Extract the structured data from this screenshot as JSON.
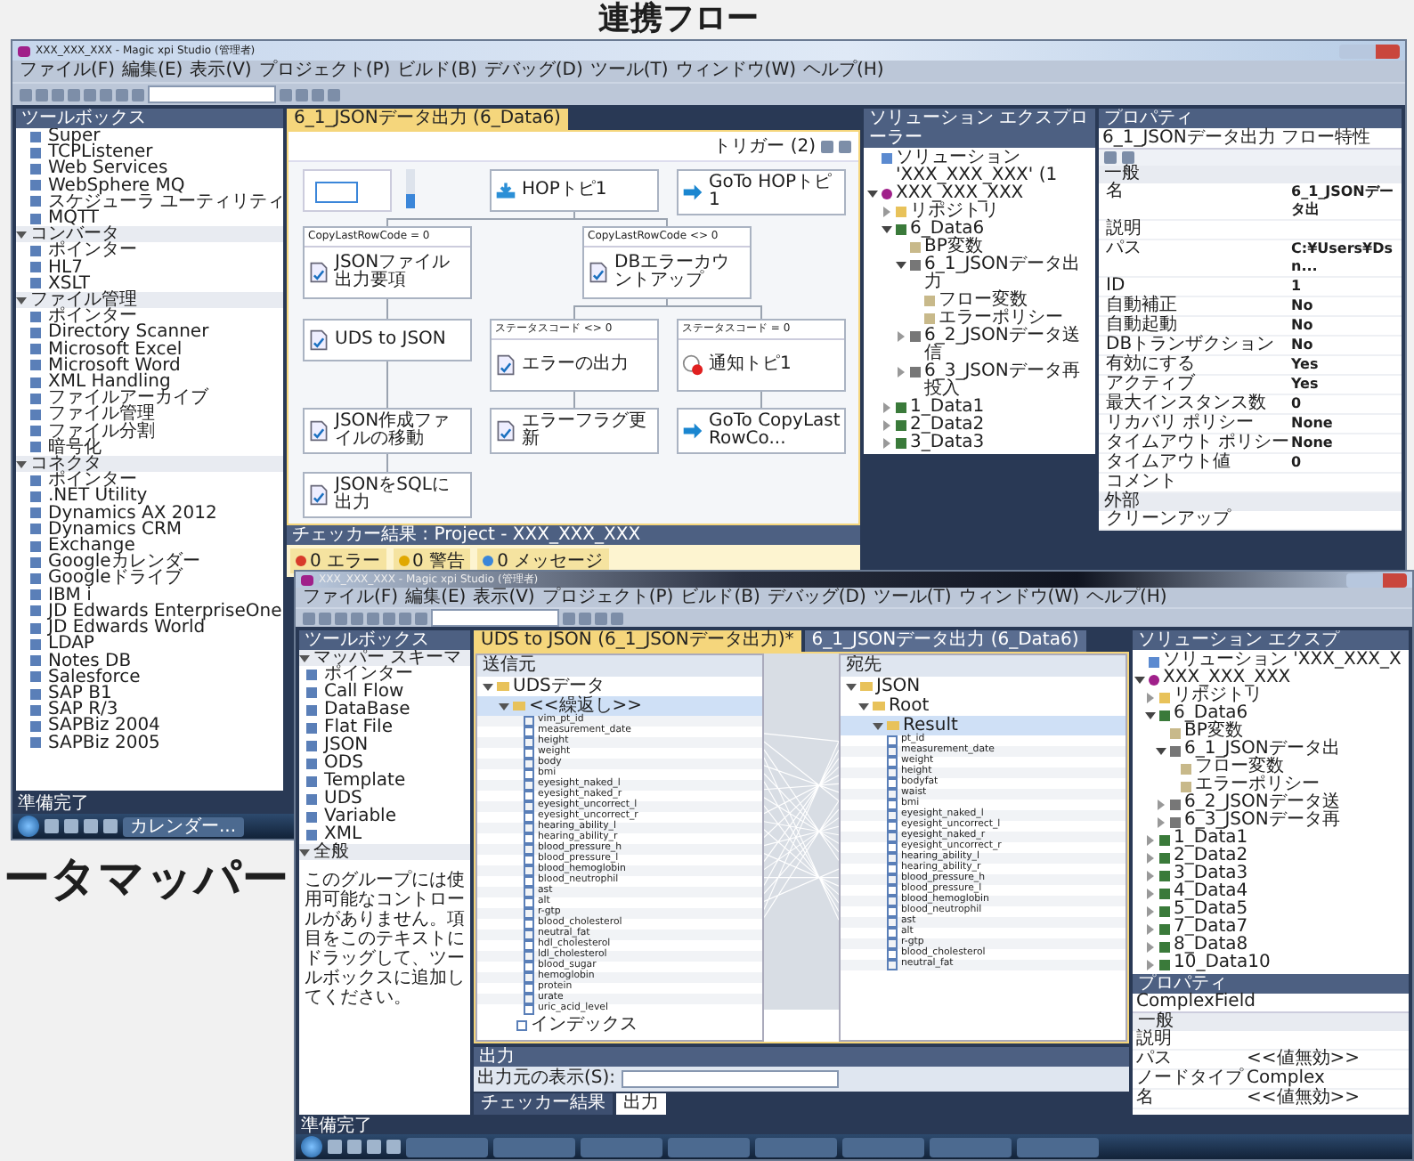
{
  "heading": "連携フロー",
  "side_label": "ータマッパー",
  "flow_window": {
    "title": "XXX_XXX_XXX - Magic xpi Studio (管理者)",
    "menu": [
      "ファイル(F)",
      "編集(E)",
      "表示(V)",
      "プロジェクト(P)",
      "ビルド(B)",
      "デバッグ(D)",
      "ツール(T)",
      "ウィンドウ(W)",
      "ヘルプ(H)"
    ],
    "toolbox": {
      "title": "ツールボックス",
      "groups": [
        {
          "items": [
            "Super",
            "TCPListener",
            "Web Services",
            "WebSphere MQ",
            "スケジューラ ユーティリティ",
            "MQTT"
          ]
        },
        {
          "name": "コンバータ",
          "expanded": true,
          "items": [
            "ポインター",
            "HL7",
            "XSLT"
          ]
        },
        {
          "name": "ファイル管理",
          "expanded": true,
          "items": [
            "ポインター",
            "Directory Scanner",
            "Microsoft Excel",
            "Microsoft Word",
            "XML Handling",
            "ファイルアーカイブ",
            "ファイル管理",
            "ファイル分割",
            "暗号化"
          ]
        },
        {
          "name": "コネクタ",
          "expanded": true,
          "items": [
            "ポインター",
            ".NET Utility",
            "Dynamics AX 2012",
            "Dynamics CRM",
            "Exchange",
            "Googleカレンダー",
            "Googleドライブ",
            "IBM i",
            "JD Edwards EnterpriseOne",
            "JD Edwards World",
            "LDAP",
            "Notes DB",
            "Salesforce",
            "SAP B1",
            "SAP R/3",
            "SAPBiz 2004",
            "SAPBiz 2005"
          ]
        }
      ]
    },
    "tab": "6_1_JSONデータ出力 (6_Data6)",
    "trigger": "トリガー (2)",
    "zoom": {
      "level": 0.35
    },
    "nodes": [
      {
        "kind": "start",
        "label": "HOPトピ1"
      },
      {
        "kind": "goto",
        "label": "GoTo HOPトピ1"
      },
      {
        "kind": "step",
        "header": "CopyLastRowCode = 0",
        "label": "JSONファイル出力要項"
      },
      {
        "kind": "step",
        "header": "CopyLastRowCode <> 0",
        "label": "DBエラーカウントアップ"
      },
      {
        "kind": "step",
        "label": "UDS to JSON"
      },
      {
        "kind": "step",
        "header": "ステータスコード <> 0",
        "label": "エラーの出力"
      },
      {
        "kind": "error",
        "header": "ステータスコード = 0",
        "label": "通知トピ1"
      },
      {
        "kind": "step",
        "label": "JSON作成ファイルの移動"
      },
      {
        "kind": "step",
        "label": "エラーフラグ更新"
      },
      {
        "kind": "goto",
        "label": "GoTo CopyLastRowCo..."
      },
      {
        "kind": "step",
        "label": "JSONをSQLに出力"
      }
    ],
    "checker": {
      "title": "チェッカー結果 : Project - XXX_XXX_XXX",
      "counts": [
        {
          "kind": "error",
          "label": "0 エラー"
        },
        {
          "kind": "warning",
          "label": "0 警告"
        },
        {
          "kind": "info",
          "label": "0 メッセージ"
        }
      ]
    },
    "solution_explorer": {
      "title": "ソリューション エクスプローラー",
      "tree": [
        {
          "label": "ソリューション 'XXX_XXX_XXX' (1",
          "kind": "solution"
        },
        {
          "label": "XXX_XXX_XXX",
          "kind": "project",
          "expanded": true,
          "children": [
            {
              "label": "リポジトリ",
              "kind": "folder",
              "expanded": false
            },
            {
              "label": "6_Data6",
              "kind": "bp",
              "expanded": true,
              "children": [
                {
                  "label": "BP変数",
                  "kind": "vars"
                },
                {
                  "label": "6_1_JSONデータ出力",
                  "kind": "flow",
                  "expanded": true,
                  "children": [
                    {
                      "label": "フロー変数",
                      "kind": "vars"
                    },
                    {
                      "label": "エラーポリシー",
                      "kind": "vars"
                    }
                  ]
                },
                {
                  "label": "6_2_JSONデータ送信",
                  "kind": "flow",
                  "expanded": false
                },
                {
                  "label": "6_3_JSONデータ再投入",
                  "kind": "flow",
                  "expanded": false
                }
              ]
            },
            {
              "label": "1_Data1",
              "kind": "bp",
              "expanded": false
            },
            {
              "label": "2_Data2",
              "kind": "bp",
              "expanded": false
            },
            {
              "label": "3_Data3",
              "kind": "bp",
              "expanded": false
            }
          ]
        }
      ]
    },
    "properties": {
      "title": "プロパティ",
      "subject": "6_1_JSONデータ出力 フロー特性",
      "groups": [
        {
          "name": "一般",
          "rows": [
            {
              "name": "名",
              "value": "6_1_JSONデータ出"
            },
            {
              "name": "説明"
            },
            {
              "name": "パス",
              "value": "C:¥Users¥Dsn..."
            },
            {
              "name": "ID",
              "value": "1"
            },
            {
              "name": "自動補正",
              "value": "No"
            },
            {
              "name": "自動起動",
              "value": "No"
            },
            {
              "name": "DBトランザクション",
              "value": "No"
            },
            {
              "name": "有効にする",
              "value": "Yes"
            },
            {
              "name": "アクティブ",
              "value": "Yes"
            },
            {
              "name": "最大インスタンス数",
              "value": "0"
            },
            {
              "name": "リカバリ ポリシー",
              "value": "None"
            },
            {
              "name": "タイムアウト ポリシー",
              "value": "None"
            },
            {
              "name": "タイムアウト値",
              "value": "0"
            },
            {
              "name": "コメント"
            }
          ]
        },
        {
          "name": "外部",
          "rows": [
            {
              "name": "クリーンアップ"
            }
          ]
        }
      ]
    },
    "status": "準備完了",
    "taskbar": [
      "カレンダー..."
    ]
  },
  "mapper_window": {
    "title": "XXX_XXX_XXX - Magic xpi Studio (管理者)",
    "menu": [
      "ファイル(F)",
      "編集(E)",
      "表示(V)",
      "プロジェクト(P)",
      "ビルド(B)",
      "デバッグ(D)",
      "ツール(T)",
      "ウィンドウ(W)",
      "ヘルプ(H)"
    ],
    "toolbox": {
      "title": "ツールボックス",
      "groups": [
        {
          "name": "マッパー スキーマ",
          "expanded": true,
          "items": [
            "ポインター",
            "Call Flow",
            "DataBase",
            "Flat File",
            "JSON",
            "ODS",
            "Template",
            "UDS",
            "Variable",
            "XML"
          ]
        },
        {
          "name": "全般",
          "expanded": true,
          "note": "このグループには使用可能なコントロールがありません。項目をこのテキストにドラッグして、ツールボックスに追加してください。"
        }
      ]
    },
    "tabs": [
      {
        "label": "UDS to JSON (6_1_JSONデータ出力)*",
        "selected": true
      },
      {
        "label": "6_1_JSONデータ出力 (6_Data6)",
        "selected": false
      }
    ],
    "source": {
      "title": "送信元",
      "root": "UDSデータ",
      "record": "<<繰返し>>",
      "fields": [
        "vim_pt_id",
        "measurement_date",
        "height",
        "weight",
        "body",
        "bmi",
        "eyesight_naked_l",
        "eyesight_naked_r",
        "eyesight_uncorrect_l",
        "eyesight_uncorrect_r",
        "hearing_ability_l",
        "hearing_ability_r",
        "blood_pressure_h",
        "blood_pressure_l",
        "blood_hemoglobin",
        "blood_neutrophil",
        "ast",
        "alt",
        "r-gtp",
        "blood_cholesterol",
        "neutral_fat",
        "hdl_cholesterol",
        "ldl_cholesterol",
        "blood_sugar",
        "hemoglobin",
        "protein",
        "urate",
        "uric_acid_level"
      ],
      "index": "インデックス"
    },
    "destination": {
      "title": "宛先",
      "root": "JSON",
      "node": "Root",
      "record": "Result",
      "fields": [
        "pt_id",
        "measurement_date",
        "weight",
        "height",
        "bodyfat",
        "waist",
        "bmi",
        "eyesight_naked_l",
        "eyesight_uncorrect_l",
        "eyesight_naked_r",
        "eyesight_uncorrect_r",
        "hearing_ability_l",
        "hearing_ability_r",
        "blood_pressure_h",
        "blood_pressure_l",
        "blood_hemoglobin",
        "blood_neutrophil",
        "ast",
        "alt",
        "r-gtp",
        "blood_cholesterol",
        "neutral_fat"
      ]
    },
    "output": {
      "title": "出力",
      "show_from": "出力元の表示(S):",
      "tabs": [
        {
          "label": "チェッカー結果",
          "selected": false
        },
        {
          "label": "出力",
          "selected": true
        }
      ]
    },
    "solution_explorer": {
      "title": "ソリューション エクスプ",
      "tree": [
        {
          "label": "ソリューション 'XXX_XXX_X",
          "kind": "solution"
        },
        {
          "label": "XXX_XXX_XXX",
          "kind": "project",
          "expanded": true,
          "children": [
            {
              "label": "リポジトリ",
              "kind": "folder",
              "expanded": false
            },
            {
              "label": "6_Data6",
              "kind": "bp",
              "expanded": true,
              "children": [
                {
                  "label": "BP変数",
                  "kind": "vars"
                },
                {
                  "label": "6_1_JSONデータ出",
                  "kind": "flow",
                  "expanded": true,
                  "children": [
                    {
                      "label": "フロー変数",
                      "kind": "vars"
                    },
                    {
                      "label": "エラーポリシー",
                      "kind": "vars"
                    }
                  ]
                },
                {
                  "label": "6_2_JSONデータ送",
                  "kind": "flow",
                  "expanded": false
                },
                {
                  "label": "6_3_JSONデータ再",
                  "kind": "flow",
                  "expanded": false
                }
              ]
            },
            {
              "label": "1_Data1",
              "kind": "bp",
              "expanded": false
            },
            {
              "label": "2_Data2",
              "kind": "bp",
              "expanded": false
            },
            {
              "label": "3_Data3",
              "kind": "bp",
              "expanded": false
            },
            {
              "label": "4_Data4",
              "kind": "bp",
              "expanded": false
            },
            {
              "label": "5_Data5",
              "kind": "bp",
              "expanded": false
            },
            {
              "label": "7_Data7",
              "kind": "bp",
              "expanded": false
            },
            {
              "label": "8_Data8",
              "kind": "bp",
              "expanded": false
            },
            {
              "label": "10_Data10",
              "kind": "bp",
              "expanded": false
            }
          ]
        }
      ]
    },
    "properties": {
      "title": "プロパティ",
      "subject": "ComplexField",
      "groups": [
        {
          "name": "一般",
          "rows": [
            {
              "name": "説明"
            },
            {
              "name": "パス",
              "value": "<<値無効>>"
            },
            {
              "name": "ノードタイプ",
              "value": "Complex"
            },
            {
              "name": "名",
              "value": "<<値無効>>"
            }
          ]
        }
      ]
    },
    "status": "準備完了"
  }
}
